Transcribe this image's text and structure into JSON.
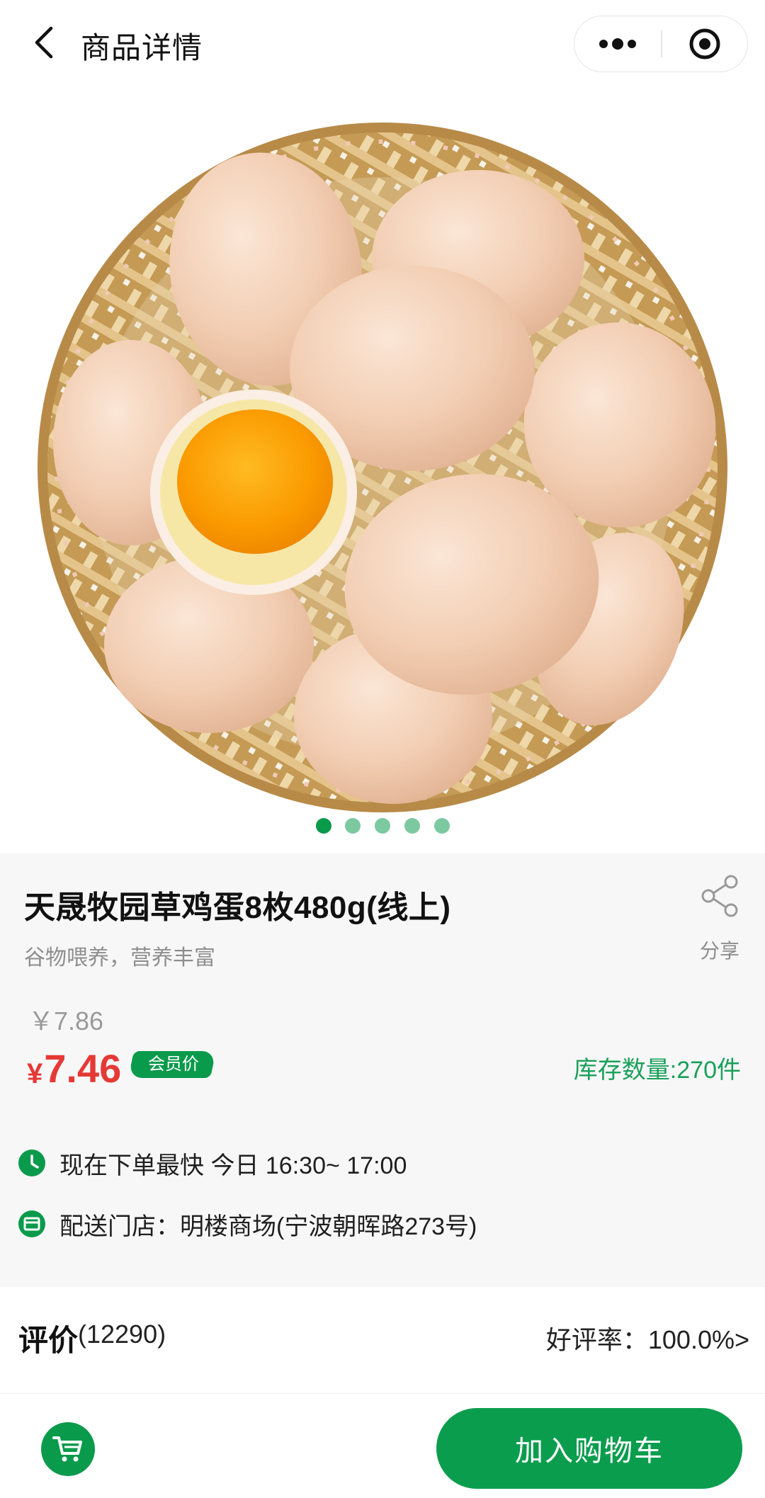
{
  "header": {
    "title": "商品详情"
  },
  "gallery": {
    "total": 5,
    "active_index": 0,
    "active_color": "#0a9a4b",
    "inactive_color": "#7cc9a0"
  },
  "product": {
    "name": "天晟牧园草鸡蛋8枚480g(线上)",
    "subtitle": "谷物喂养，营养丰富",
    "share_label": "分享",
    "original_price": "￥7.86",
    "currency": "¥",
    "price": "7.46",
    "member_badge": "会员价",
    "stock": "库存数量:270件"
  },
  "delivery": {
    "time_text": "现在下单最快 今日 16:30~ 17:00",
    "store_text": "配送门店：明楼商场(宁波朝晖路273号)"
  },
  "reviews": {
    "title": "评价",
    "count": "(12290)",
    "rate": "好评率：100.0%>"
  },
  "bottom_bar": {
    "add_to_cart": "加入购物车"
  },
  "colors": {
    "brand_green": "#0a9a4b",
    "price_red": "#e53935",
    "stock_green": "#19a05a"
  }
}
